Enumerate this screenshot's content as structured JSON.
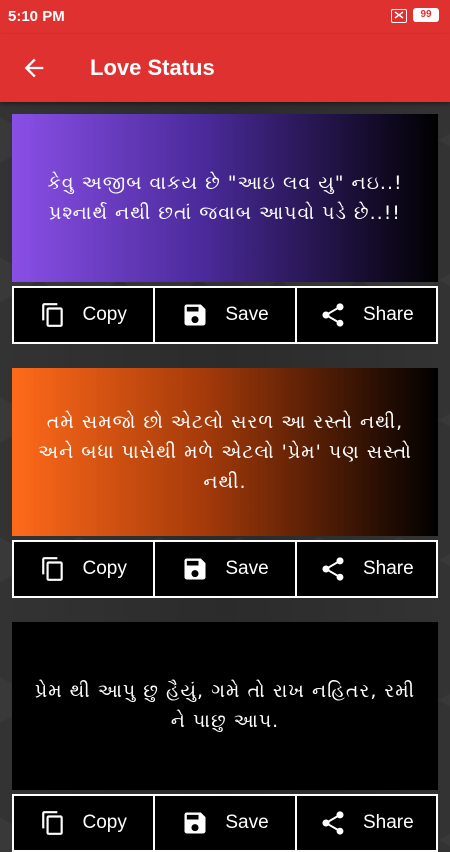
{
  "status_bar": {
    "time": "5:10 PM",
    "battery": "99"
  },
  "app_bar": {
    "title": "Love Status"
  },
  "cards": [
    {
      "quote": "કેવુ અજીબ વાકય છે \"આઇ લવ યુ\" નઇ..! પ્રશ્નાર્થ નથી છતાં જવાબ આપવો પડે છે..!!",
      "gradient_start": "#8a4fe6",
      "gradient_end": "#000000"
    },
    {
      "quote": "તમે સમજો છો એટલો સરળ આ રસ્તો નથી, અને બધા પાસેથી મળે એટલો 'પ્રેમ' પણ સસ્તો નથી.",
      "gradient_start": "#ff6a1a",
      "gradient_end": "#000000"
    },
    {
      "quote": "પ્રેમ થી આપુ છુ હૈયું, ગમે તો રાખ નહિતર, રમી ને પાછુ આપ.",
      "gradient_start": "#000000",
      "gradient_end": "#000000"
    }
  ],
  "actions": {
    "copy": "Copy",
    "save": "Save",
    "share": "Share"
  },
  "colors": {
    "accent": "#e03131"
  }
}
